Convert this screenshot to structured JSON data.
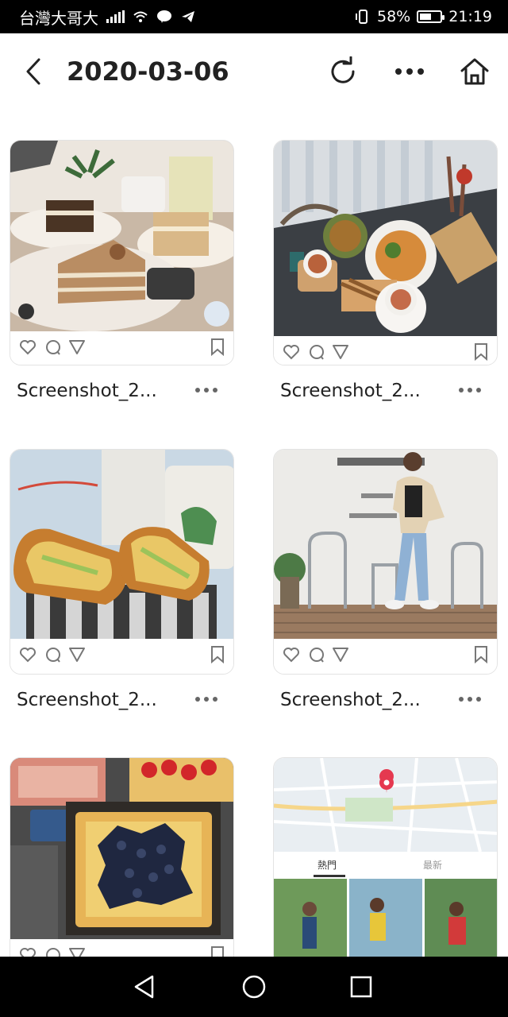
{
  "status_bar": {
    "carrier": "台灣大哥大",
    "battery_percent": "58%",
    "battery_level": 0.58,
    "time": "21:19",
    "icons": [
      "signal-icon",
      "wifi-icon",
      "line-icon",
      "telegram-icon",
      "vibrate-icon",
      "battery-icon"
    ]
  },
  "header": {
    "title": "2020-03-06",
    "back_icon": "chevron-left-icon",
    "actions": [
      "refresh-icon",
      "more-horizontal-icon",
      "home-icon"
    ]
  },
  "grid": {
    "items": [
      {
        "name": "Screenshot_2...",
        "thumb": "cakes-photo"
      },
      {
        "name": "Screenshot_2...",
        "thumb": "cafe-table-photo"
      },
      {
        "name": "Screenshot_2...",
        "thumb": "toast-sandwich-photo"
      },
      {
        "name": "Screenshot_2...",
        "thumb": "woman-cafe-photo"
      },
      {
        "name": "",
        "thumb": "blueberry-tart-photo"
      },
      {
        "name": "",
        "thumb": "map-screenshot"
      }
    ],
    "map_tabs": [
      "熱門",
      "最新"
    ]
  },
  "nav_bar": {
    "buttons": [
      "back-triangle-icon",
      "home-circle-icon",
      "recents-square-icon"
    ]
  },
  "colors": {
    "status_bar_bg": "#000000",
    "background": "#ffffff",
    "title_text": "#222222",
    "map_pin": "#e53950"
  }
}
